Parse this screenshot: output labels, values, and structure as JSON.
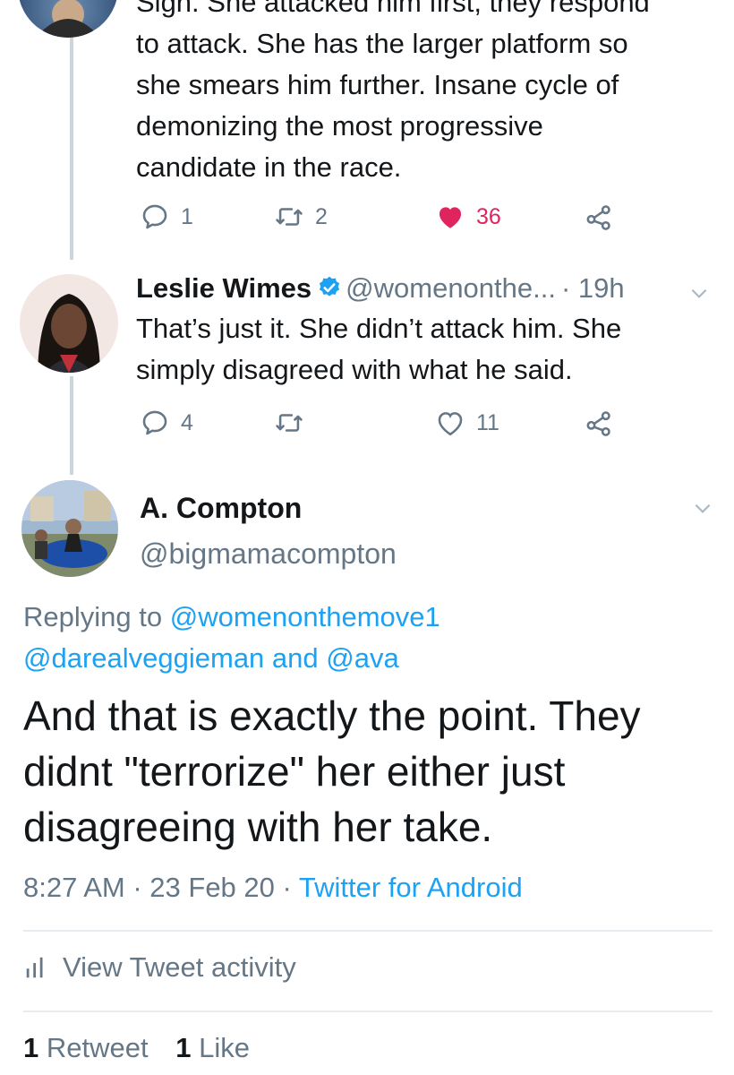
{
  "thread": {
    "tweet1": {
      "text_lines": [
        "Sigh. She attacked him first, they respond",
        "to attack. She has the larger platform so",
        "she smears him further. Insane cycle of",
        "demonizing the most progressive",
        "candidate in the race."
      ],
      "reply_count": "1",
      "retweet_count": "2",
      "like_count": "36"
    },
    "tweet2": {
      "name": "Leslie Wimes",
      "handle": "@womenonthe...",
      "time": "· 19h",
      "text_lines": [
        "That’s just it. She didn’t attack him. She",
        "simply disagreed with what he said."
      ],
      "reply_count": "4",
      "retweet_count": "",
      "like_count": "11"
    }
  },
  "main_tweet": {
    "name": "A. Compton",
    "handle": "@bigmamacompton",
    "replying_prefix": "Replying to ",
    "replying_user1": "@womenonthemove1",
    "replying_user2": "@darealveggieman",
    "replying_and": " and ",
    "replying_user3": "@ava",
    "text_lines": [
      "And that is exactly the point. They",
      "didnt \"terrorize\" her either just",
      "disagreeing with her take."
    ],
    "time": "8:27 AM · 23 Feb 20 · ",
    "source": "Twitter for Android"
  },
  "activity_label": "View Tweet activity",
  "stats": {
    "retweets_count": "1",
    "retweets_label": " Retweet",
    "likes_count": "1",
    "likes_label": " Like"
  },
  "colors": {
    "link": "#1da1f2",
    "secondary_text": "#657786",
    "like": "#e0245e",
    "verified": "#1da1f2"
  }
}
